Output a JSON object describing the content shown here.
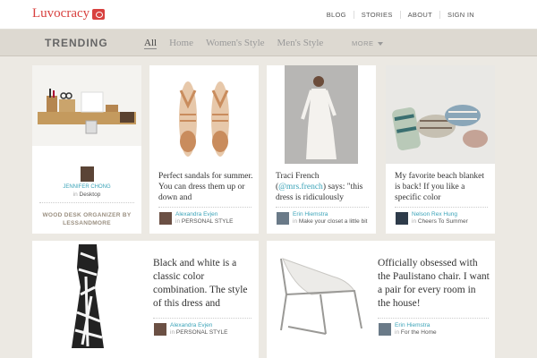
{
  "topbar": {
    "logo": "Luvocracy",
    "nav": [
      "BLOG",
      "STORIES",
      "ABOUT",
      "SIGN IN"
    ]
  },
  "trending": {
    "title": "TRENDING",
    "tabs": [
      "All",
      "Home",
      "Women's Style",
      "Men's Style"
    ],
    "active_tab": "All",
    "more": "MORE"
  },
  "cards": {
    "c1": {
      "user": "JENNIFER CHONG",
      "in": "in",
      "board": "Desktop",
      "caption": "WOOD DESK ORGANIZER BY LESSANDMORE"
    },
    "c2": {
      "desc": "Perfect sandals for summer. You can dress them up or down and",
      "user": "Alexandra Evjen",
      "in": "in",
      "board": "PERSONAL STYLE"
    },
    "c3": {
      "desc1": "Traci French",
      "handle": "@mrs.french",
      "desc2": "says: \"this dress is ridiculously",
      "user": "Erin Hiemstra",
      "in": "in",
      "board": "Make your closet a little bit"
    },
    "c4": {
      "desc": "My favorite beach blanket is back! If you like a specific color",
      "user": "Nelson Rex Hung",
      "in": "in",
      "board": "Cheers To Summer"
    },
    "c5": {
      "desc": "Black and white is a classic color combination. The style of this dress and",
      "user": "Alexandra Evjen",
      "in": "in",
      "board": "PERSONAL STYLE"
    },
    "c6": {
      "desc": "Officially obsessed with the Paulistano chair. I want a pair for every room in the house!",
      "user": "Erin Hiemstra",
      "in": "in",
      "board": "For the Home"
    }
  },
  "colors": {
    "accent": "#d8413f",
    "link": "#3ba3b8",
    "background": "#ece9e3"
  }
}
